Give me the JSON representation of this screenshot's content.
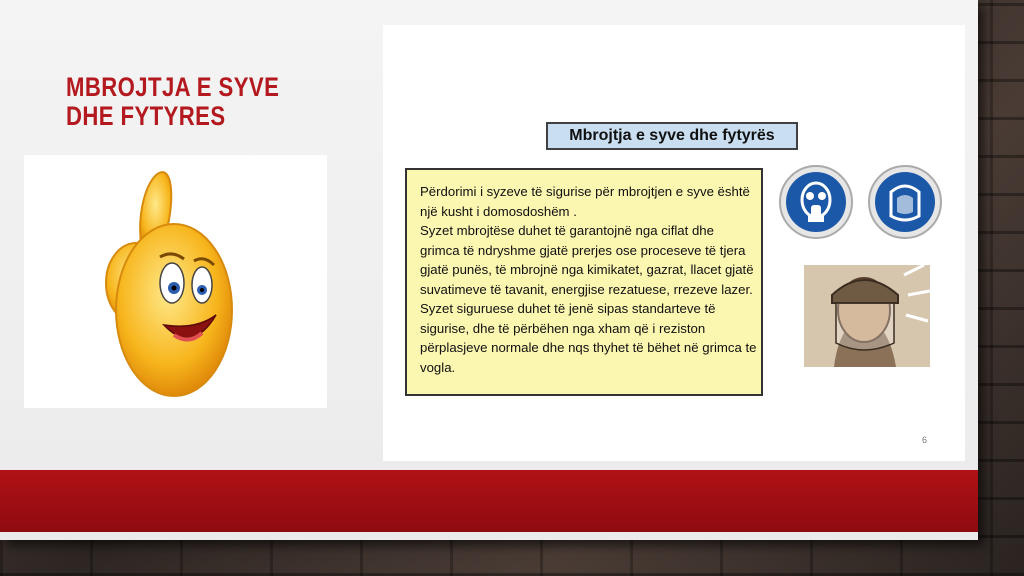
{
  "slide": {
    "title": "MBROJTJA E SYVE DHE FYTYRES"
  },
  "content": {
    "heading": "Mbrojtja e syve dhe fytyrës",
    "paragraph1": "Përdorimi i syzeve të sigurise për mbrojtjen e syve është një kusht i domosdoshëm .",
    "paragraph2": "Syzet mbrojtëse duhet të garantojnë nga ciflat dhe grimca të ndryshme gjatë prerjes ose proceseve të tjera gjatë punës, të mbrojnë nga kimikatet, gazrat, llacet gjatë suvatimeve të tavanit, energjise rezatuese, rrezeve lazer.",
    "paragraph3": "Syzet siguruese duhet të jenë sipas standarteve të sigurise, dhe të përbëhen nga xham që i reziston përplasjeve normale dhe nqs thyhet të bëhet në grimca te vogla.",
    "page_number": "6"
  },
  "icons": {
    "smiley": "thumbs-up-smiley-icon",
    "gas_mask_sign": "gas-mask-sign-icon",
    "face_shield_sign": "face-shield-sign-icon",
    "worker_photo": "face-shield-worker-illustration"
  },
  "colors": {
    "title_red": "#b3191e",
    "band_red": "#a50f14",
    "text_box_yellow": "#fbf6b0",
    "heading_box_blue": "#c9def0",
    "sign_blue": "#1c58a8"
  }
}
